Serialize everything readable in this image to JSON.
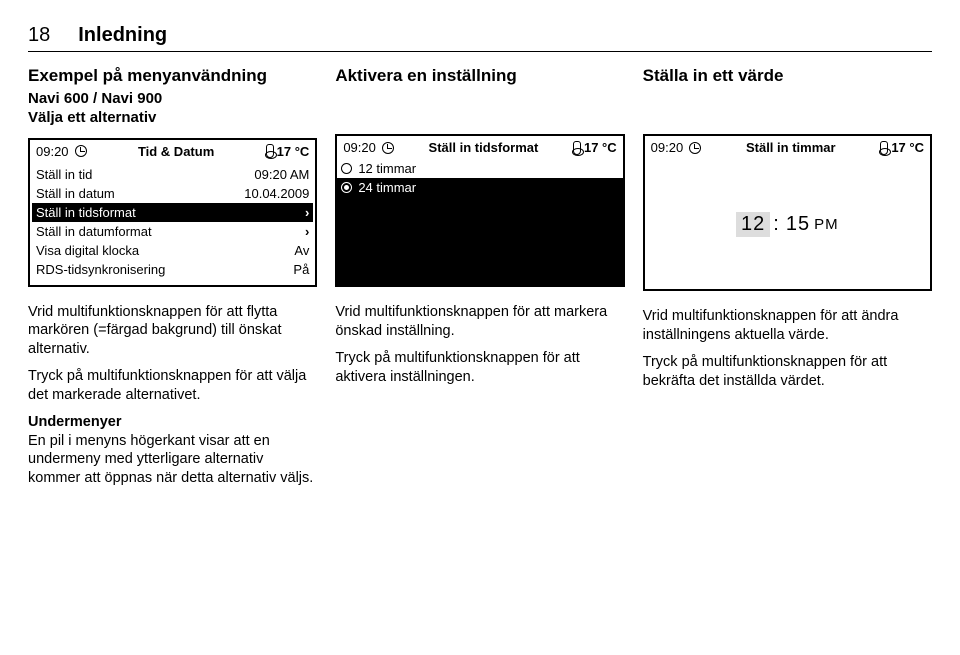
{
  "page": {
    "number": "18",
    "section": "Inledning"
  },
  "col1": {
    "heading": "Exempel på menyanvändning",
    "subhead": "Navi 600 / Navi 900\nVälja ett alternativ",
    "screen": {
      "time": "09:20",
      "title": "Tid & Datum",
      "temp": "17 °C",
      "rows": [
        {
          "label": "Ställ in tid",
          "value": "09:20 AM"
        },
        {
          "label": "Ställ in datum",
          "value": "10.04.2009"
        },
        {
          "label": "Ställ in tidsformat",
          "value": "›",
          "selected": true
        },
        {
          "label": "Ställ in datumformat",
          "value": "›"
        },
        {
          "label": "Visa digital klocka",
          "value": "Av"
        },
        {
          "label": "RDS-tidsynkronisering",
          "value": "På"
        }
      ]
    },
    "p1": "Vrid multifunktionsknappen för att flytta markören (=färgad bakgrund) till önskat alternativ.",
    "p2": "Tryck på multifunktionsknappen för att välja det markerade alternativet.",
    "submenuTitle": "Undermenyer",
    "p3": "En pil i menyns högerkant visar att en undermeny med ytterligare alternativ kommer att öppnas när detta alternativ väljs."
  },
  "col2": {
    "heading": "Aktivera en inställning",
    "screen": {
      "time": "09:20",
      "title": "Ställ in tidsformat",
      "temp": "17 °C",
      "opt1": "12 timmar",
      "opt2": "24 timmar"
    },
    "p1": "Vrid multifunktionsknappen för att markera önskad inställning.",
    "p2": "Tryck på multifunktionsknappen för att aktivera inställningen."
  },
  "col3": {
    "heading": "Ställa in ett värde",
    "screen": {
      "time": "09:20",
      "title": "Ställ in timmar",
      "temp": "17 °C",
      "hours": "12",
      "minutes": "15",
      "ampm": "PM"
    },
    "p1": "Vrid multifunktionsknappen för att ändra inställningens aktuella värde.",
    "p2": "Tryck på multifunktionsknappen för att bekräfta det inställda värdet."
  }
}
